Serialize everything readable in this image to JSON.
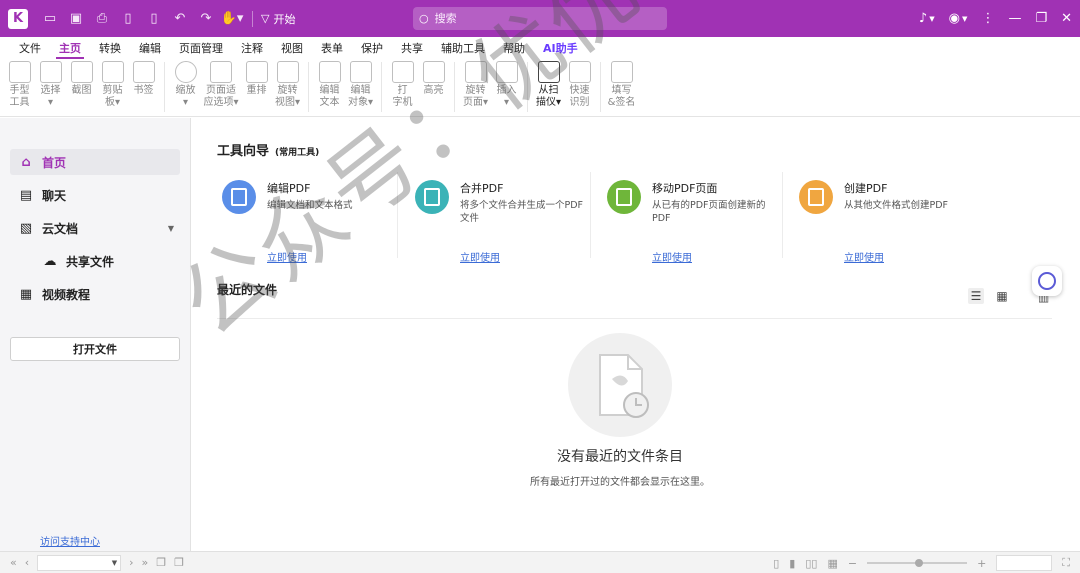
{
  "app": {
    "logo_letter": "K"
  },
  "titlebar": {
    "start_label": "开始",
    "search_placeholder": "搜索"
  },
  "menu": {
    "tabs": [
      {
        "label": "文件"
      },
      {
        "label": "主页",
        "active": true
      },
      {
        "label": "转换"
      },
      {
        "label": "编辑"
      },
      {
        "label": "页面管理"
      },
      {
        "label": "注释"
      },
      {
        "label": "视图"
      },
      {
        "label": "表单"
      },
      {
        "label": "保护"
      },
      {
        "label": "共享"
      },
      {
        "label": "辅助工具"
      },
      {
        "label": "帮助"
      },
      {
        "label": "AI助手"
      }
    ]
  },
  "ribbon": {
    "buttons": [
      {
        "label": "手型\n工具"
      },
      {
        "label": "选择\n▾"
      },
      {
        "label": "截图"
      },
      {
        "label": "剪贴\n板▾"
      },
      {
        "label": "书签"
      },
      {
        "label": "缩放\n▾"
      },
      {
        "label": "页面适\n应选项▾"
      },
      {
        "label": "重排"
      },
      {
        "label": "旋转\n视图▾"
      },
      {
        "label": "编辑\n文本"
      },
      {
        "label": "编辑\n对象▾"
      },
      {
        "label": "打\n字机"
      },
      {
        "label": "高亮"
      },
      {
        "label": "旋转\n页面▾"
      },
      {
        "label": "插入\n▾"
      },
      {
        "label": "从扫\n描仪▾"
      },
      {
        "label": "快速\n识别"
      },
      {
        "label": "填写\n&签名"
      }
    ]
  },
  "sidebar": {
    "items": [
      {
        "label": "首页",
        "icon": "home-icon",
        "active": true
      },
      {
        "label": "聊天",
        "icon": "chat-icon"
      },
      {
        "label": "云文档",
        "icon": "cloud-doc-icon"
      },
      {
        "label": "共享文件",
        "icon": "cloud-share-icon"
      },
      {
        "label": "视频教程",
        "icon": "video-icon"
      }
    ],
    "open_file": "打开文件",
    "support_link": "访问支持中心"
  },
  "main": {
    "tools_title": "工具向导",
    "tools_subtitle": "(常用工具)",
    "cards": [
      {
        "title": "编辑PDF",
        "desc": "编辑文档和文本格式",
        "link": "立即使用",
        "color": "#5a8ee8"
      },
      {
        "title": "合并PDF",
        "desc": "将多个文件合并生成一个PDF文件",
        "link": "立即使用",
        "color": "#3bb3b7"
      },
      {
        "title": "移动PDF页面",
        "desc": "从已有的PDF页面创建新的PDF",
        "link": "立即使用",
        "color": "#6fb63a"
      },
      {
        "title": "创建PDF",
        "desc": "从其他文件格式创建PDF",
        "link": "立即使用",
        "color": "#f0a640"
      }
    ],
    "recent_title": "最近的文件",
    "empty_title": "没有最近的文件条目",
    "empty_subtitle": "所有最近打开过的文件都会显示在这里。"
  },
  "watermark": "公众号：优优软件安装"
}
